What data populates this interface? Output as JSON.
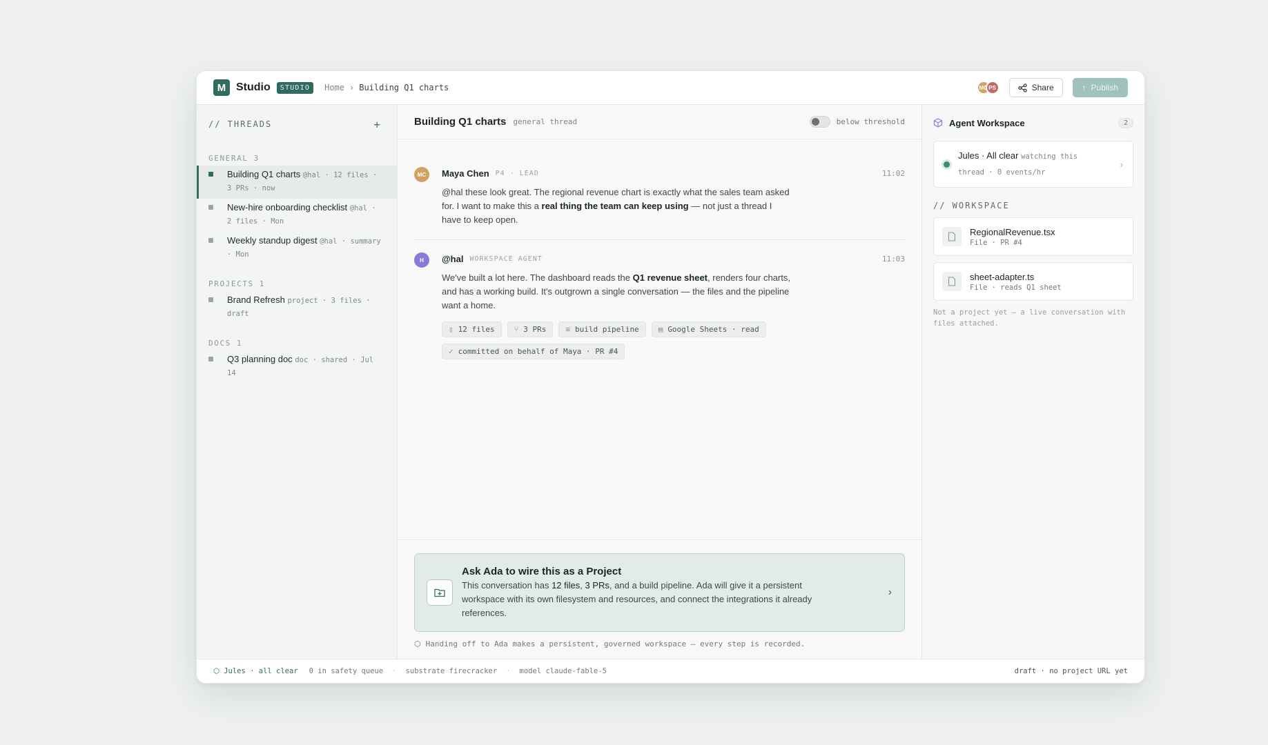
{
  "topbar": {
    "logo_letter": "M",
    "brand": "Studio",
    "badge": "STUDIO",
    "breadcrumb": [
      "Home",
      "Building Q1 charts"
    ],
    "avatars": [
      {
        "initials": "MC",
        "color": "#d2a160"
      },
      {
        "initials": "PS",
        "color": "#c06a6a"
      }
    ],
    "share_label": "Share",
    "publish_label": "Publish"
  },
  "sidebar": {
    "heading": "// THREADS",
    "groups": [
      {
        "label": "GENERAL",
        "count": "3"
      },
      {
        "label": "PROJECTS",
        "count": "1"
      },
      {
        "label": "DOCS",
        "count": "1"
      }
    ],
    "threads": [
      {
        "title": "Building Q1 charts",
        "meta": "@hal · 12 files · 3 PRs · now"
      },
      {
        "title": "New-hire onboarding checklist",
        "meta": "@hal · 2 files · Mon"
      },
      {
        "title": "Weekly standup digest",
        "meta": "@hal · summary · Mon"
      },
      {
        "title": "Brand Refresh",
        "meta": "project · 3 files · draft"
      },
      {
        "title": "Q3 planning doc",
        "meta": "doc · shared · Jul 14"
      }
    ]
  },
  "main": {
    "title": "Building Q1 charts",
    "subtitle": "general thread",
    "toggle_label": "below threshold",
    "messages": [
      {
        "initials": "MC",
        "avatar_color": "#d2a160",
        "name": "Maya Chen",
        "role": "P4 · LEAD",
        "time": "11:02",
        "body_1": "@hal these look great. The regional revenue chart is exactly what the sales team asked for. I want to make this a ",
        "body_bold": "real thing the team can keep using",
        "body_2": " — not just a thread I have to keep open."
      },
      {
        "initials": "H",
        "avatar_color": "#8a79d6",
        "name": "@hal",
        "role": "WORKSPACE AGENT",
        "time": "11:03",
        "body_1": "We've built a lot here. The dashboard reads the ",
        "body_bold": "Q1 revenue sheet",
        "body_2": ", renders four charts, and has a working build. It's outgrown a single conversation — the files and the pipeline want a home.",
        "chips": [
          "12 files",
          "3 PRs",
          "build pipeline",
          "Google Sheets · read"
        ],
        "commit": "committed on behalf of Maya · PR #4"
      }
    ],
    "cta": {
      "title": "Ask Ada to wire this as a Project",
      "d1": "This conversation has ",
      "files": "12 files",
      "d2": ", ",
      "prs": "3 PRs",
      "d3": ", and a build pipeline. Ada will give it a persistent workspace with its own filesystem and resources, and connect the integrations it already references."
    },
    "handoff": "Handing off to Ada makes a persistent, governed workspace — every step is recorded."
  },
  "right": {
    "title": "Agent Workspace",
    "count": "2",
    "jules_name": "Jules · All clear",
    "jules_meta": "watching this thread · 0 events/hr",
    "workspace_heading": "// WORKSPACE",
    "files": [
      {
        "name": "RegionalRevenue.tsx",
        "meta": "File · PR #4"
      },
      {
        "name": "sheet-adapter.ts",
        "meta": "File · reads Q1 sheet"
      }
    ],
    "note": "Not a project yet — a live conversation with files attached."
  },
  "status": {
    "jules": "Jules · all clear",
    "queue": "0 in safety queue",
    "substrate": "substrate firecracker",
    "model": "model claude-fable-5",
    "right": "draft · no project URL yet"
  }
}
